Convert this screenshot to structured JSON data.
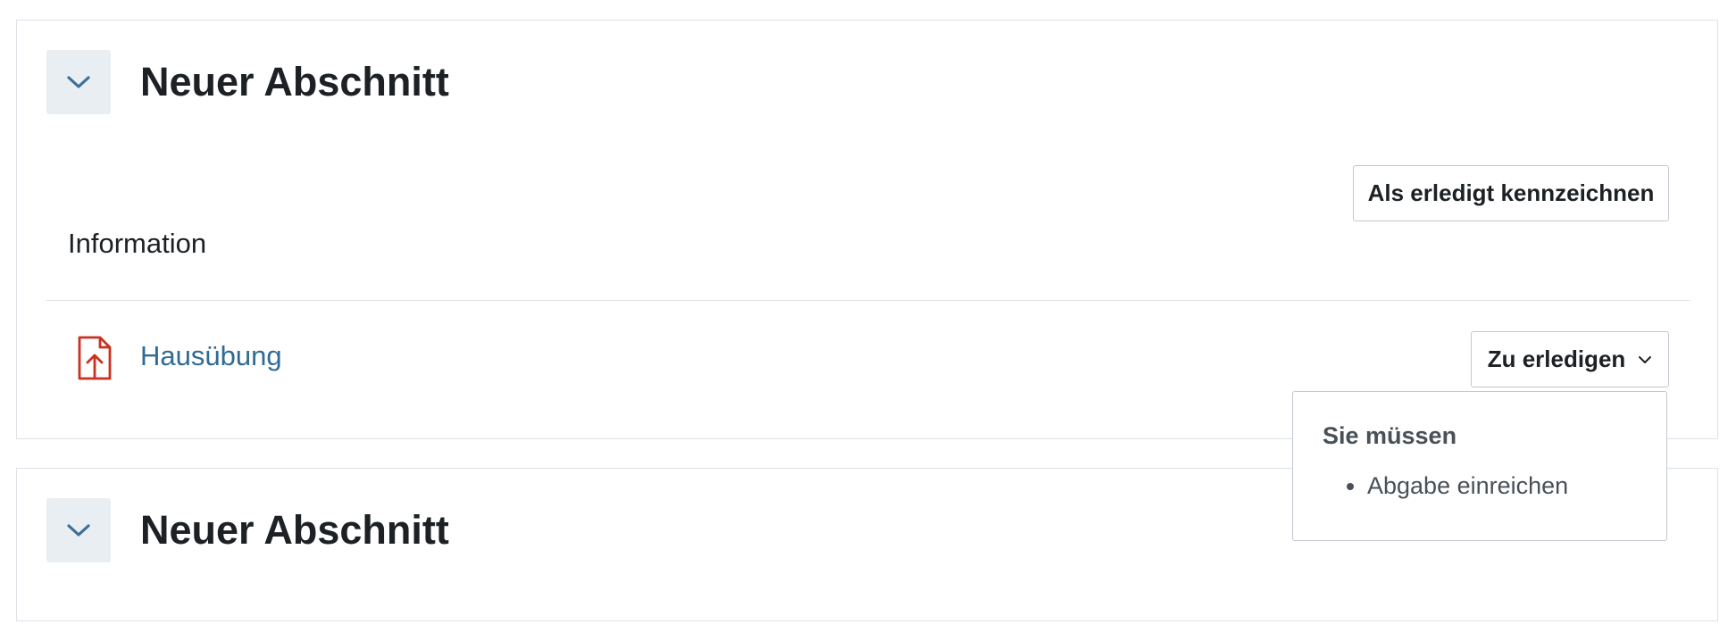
{
  "sections": [
    {
      "title": "Neuer Abschnitt",
      "collapse_icon": "chevron-down-icon",
      "complete_button": "Als erledigt kennzeichnen",
      "summary_label": "Information",
      "activities": [
        {
          "name": "Hausübung",
          "icon": "file-upload-icon",
          "status_dropdown": "Zu erledigen",
          "popover": {
            "title": "Sie müssen",
            "items": [
              "Abgabe einreichen"
            ]
          }
        }
      ]
    },
    {
      "title": "Neuer Abschnitt",
      "collapse_icon": "chevron-down-icon"
    }
  ],
  "colors": {
    "link": "#2f6b94",
    "icon_red": "#ca3120",
    "chevron_blue": "#3e6f96",
    "collapse_bg": "#e9eef3",
    "border": "#dee2e6"
  }
}
